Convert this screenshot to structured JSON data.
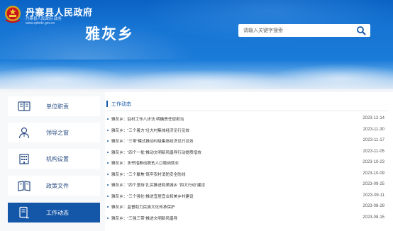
{
  "header": {
    "site_name": "丹寨县人民政府",
    "site_sub": "丹寨县人民政府 政务",
    "site_url": "www.qdndz.gov.cn",
    "town_name": "雅灰乡",
    "search_placeholder": "请输入关键字搜索",
    "search_icon": "search-icon",
    "emblem_icon": "national-emblem-icon"
  },
  "colors": {
    "header_blue": "#1674d3",
    "active_nav": "#1456a8",
    "accent_text": "#2c4f86"
  },
  "sidebar": {
    "items": [
      {
        "label": "单位职责",
        "icon": "duty-book-icon",
        "active": false
      },
      {
        "label": "领导之窗",
        "icon": "leader-person-icon",
        "active": false
      },
      {
        "label": "机构设置",
        "icon": "org-building-icon",
        "active": false
      },
      {
        "label": "政策文件",
        "icon": "policy-document-icon",
        "active": false
      },
      {
        "label": "工作动态",
        "icon": "work-news-icon",
        "active": true
      }
    ]
  },
  "main": {
    "section_title": "工作动态",
    "news": [
      {
        "title": "雅灰乡：驻村工作八步法 明确责任促担当",
        "date": "2023-12-14"
      },
      {
        "title": "雅灰乡：“三个着力”壮大村集体经济见行见效",
        "date": "2023-11-30"
      },
      {
        "title": "雅灰乡：“三带”模式推动村级集体经济见行见效",
        "date": "2023-11-17"
      },
      {
        "title": "雅灰乡：“四个一批”推动文明新风倡导行动提质增效",
        "date": "2023-11-05"
      },
      {
        "title": "雅灰乡：多举措推动脱贫人口稳岗就业",
        "date": "2023-10-23"
      },
      {
        "title": "雅灰乡：“三个聚焦”筑牢农村消防安全防线",
        "date": "2023-10-09"
      },
      {
        "title": "雅灰乡：“四个坚持”扎实推进和美城乡 “四大行动”建设",
        "date": "2023-09-25"
      },
      {
        "title": "雅灰乡：“三个强化”推进宜居宜业和美乡村建设",
        "date": "2023-09-11"
      },
      {
        "title": "雅灰乡：监督助力民族文化传承保护",
        "date": "2023-08-28"
      },
      {
        "title": "雅灰乡：“三强三带”推进文明新风倡导",
        "date": "2023-08-15"
      }
    ]
  }
}
